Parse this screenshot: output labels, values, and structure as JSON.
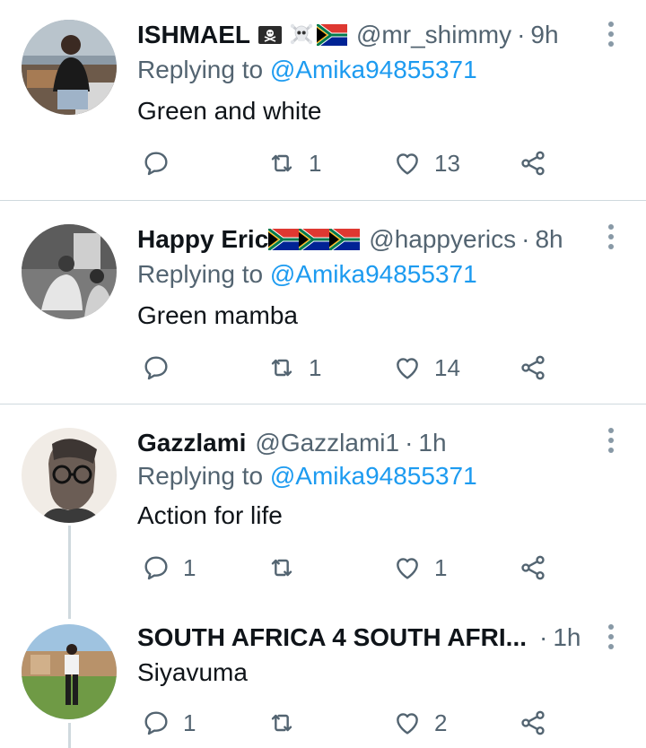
{
  "tweets": [
    {
      "name": "ISHMAEL",
      "handle": "@mr_shimmy",
      "separator": "·",
      "time": "9h",
      "replying_prefix": "Replying to",
      "replying_to": "@Amika94855371",
      "text": "Green and white",
      "replies": "",
      "retweets": "1",
      "likes": "13",
      "name_emojis": [
        "skull-crossbones-flag",
        "skull-crossbones",
        "south-africa-flag"
      ]
    },
    {
      "name": "Happy Eric",
      "handle": "@happyerics",
      "separator": "·",
      "time": "8h",
      "replying_prefix": "Replying to",
      "replying_to": "@Amika94855371",
      "text": "Green mamba",
      "replies": "",
      "retweets": "1",
      "likes": "14",
      "name_emojis": [
        "south-africa-flag",
        "south-africa-flag",
        "south-africa-flag"
      ]
    },
    {
      "name": "Gazzlami",
      "handle": "@Gazzlami1",
      "separator": "·",
      "time": "1h",
      "replying_prefix": "Replying to",
      "replying_to": "@Amika94855371",
      "text": "Action for life",
      "replies": "1",
      "retweets": "",
      "likes": "1"
    },
    {
      "name": "SOUTH AFRICA 4 SOUTH AFRI...",
      "handle": "",
      "separator": "·",
      "time": "1h",
      "text": "Siyavuma",
      "replies": "1",
      "retweets": "",
      "likes": "2"
    }
  ],
  "colors": {
    "accent": "#1d9bf0",
    "secondary_text": "#536471",
    "divider": "#cfd9de"
  },
  "icons": [
    "reply-icon",
    "retweet-icon",
    "like-icon",
    "share-icon",
    "more-icon"
  ]
}
